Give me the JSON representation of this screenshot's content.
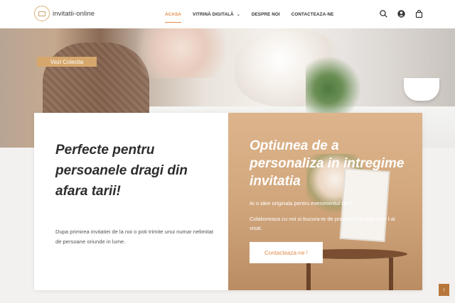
{
  "header": {
    "logo_text": "invitatii-online",
    "nav": [
      {
        "label": "ACASA",
        "active": true
      },
      {
        "label": "VITRINĂ DIGITALĂ",
        "has_dropdown": true
      },
      {
        "label": "DESPRE NOI"
      },
      {
        "label": "CONTACTEAZA-NE"
      }
    ],
    "icons": [
      "search-icon",
      "user-icon",
      "cart-icon"
    ]
  },
  "hero": {
    "button_label": "Vezi Colectia"
  },
  "card_left": {
    "title": "Perfecte pentru persoanele dragi din afara tarii!",
    "body": "Dupa primirea invitatiei de la noi o poti trimite unui numar nelimitat de persoane oriunde in lume."
  },
  "card_right": {
    "title": "Optiunea de a personaliza in intregime invitatia",
    "p1": "Ai o idee originala pentru evenimentul tau?",
    "p2": "Colaboreaza cu noi si bucura-te de produsul tau asa cum l-ai visat.",
    "button_label": "Contacteaza-ne !"
  },
  "scroll_top_icon": "arrow-up-icon",
  "colors": {
    "accent": "#e38b4b",
    "card_right_bg": "#d4aa80",
    "scroll_top": "#b7773a"
  }
}
